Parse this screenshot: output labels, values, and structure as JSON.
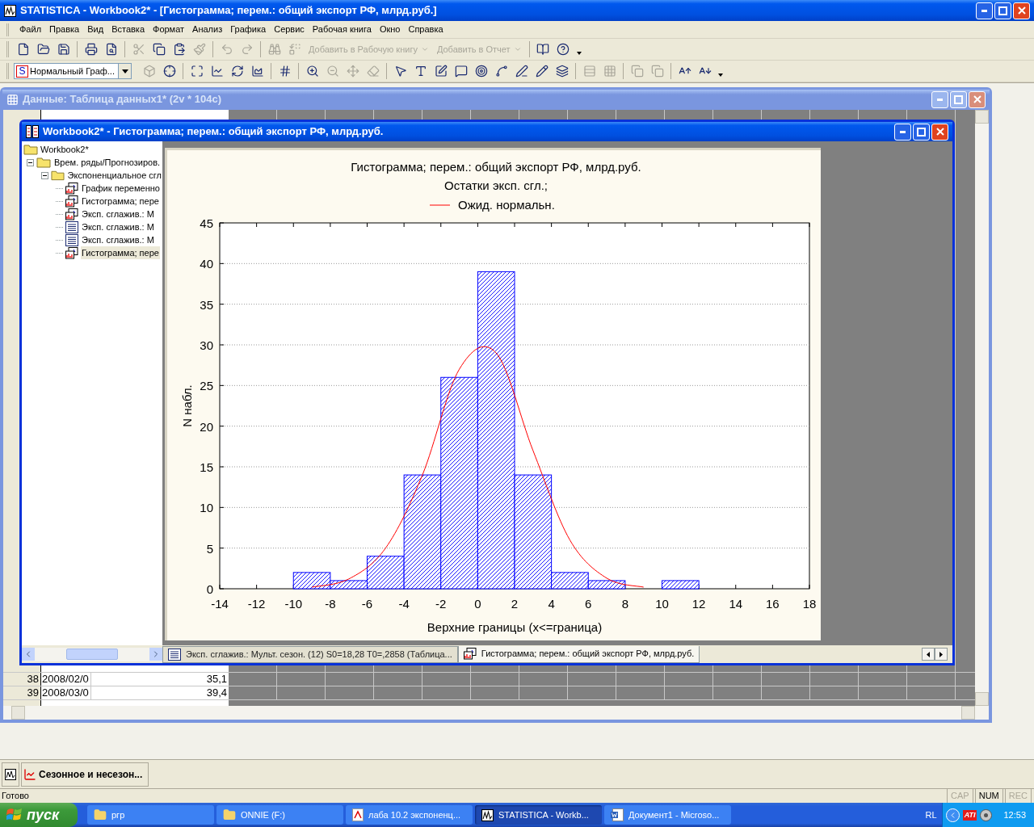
{
  "app_window": {
    "title": "STATISTICA - Workbook2* - [Гистограмма; перем.: общий экспорт РФ, млрд.руб.]",
    "active": true
  },
  "menu": [
    "Файл",
    "Правка",
    "Вид",
    "Вставка",
    "Формат",
    "Анализ",
    "Графика",
    "Сервис",
    "Рабочая книга",
    "Окно",
    "Справка"
  ],
  "toolbar_standard": [
    {
      "kind": "icon",
      "disabled": false
    },
    {
      "kind": "icon",
      "disabled": false
    },
    {
      "kind": "icon",
      "disabled": false
    },
    {
      "kind": "separator"
    },
    {
      "kind": "icon",
      "disabled": false
    },
    {
      "kind": "icon",
      "disabled": false
    },
    {
      "kind": "separator"
    },
    {
      "kind": "icon",
      "disabled": true
    },
    {
      "kind": "icon",
      "disabled": false
    },
    {
      "kind": "icon",
      "disabled": false
    },
    {
      "kind": "icon",
      "disabled": true
    },
    {
      "kind": "separator"
    },
    {
      "kind": "icon",
      "disabled": true
    },
    {
      "kind": "icon",
      "disabled": true
    },
    {
      "kind": "separator"
    },
    {
      "kind": "icon",
      "disabled": true
    },
    {
      "kind": "icon",
      "disabled": true
    },
    {
      "kind": "dropdown",
      "label": "Добавить в Рабочую книгу",
      "disabled": true
    },
    {
      "kind": "dropdown",
      "label": "Добавить в Отчет",
      "disabled": true
    },
    {
      "kind": "separator"
    },
    {
      "kind": "icon",
      "disabled": false
    },
    {
      "kind": "icon",
      "disabled": false
    },
    {
      "kind": "more"
    }
  ],
  "toolbar_graphs": [
    {
      "kind": "combo",
      "badge": "S",
      "label": "Нормальный Граф..."
    },
    {
      "kind": "icon",
      "disabled": true
    },
    {
      "kind": "icon",
      "disabled": false
    },
    {
      "kind": "separator"
    },
    {
      "kind": "icon",
      "disabled": false
    },
    {
      "kind": "icon",
      "disabled": false
    },
    {
      "kind": "icon",
      "disabled": false
    },
    {
      "kind": "icon",
      "disabled": false
    },
    {
      "kind": "separator"
    },
    {
      "kind": "icon",
      "disabled": false
    },
    {
      "kind": "separator"
    },
    {
      "kind": "icon",
      "disabled": false
    },
    {
      "kind": "icon",
      "disabled": true
    },
    {
      "kind": "icon",
      "disabled": true
    },
    {
      "kind": "icon",
      "disabled": true
    },
    {
      "kind": "separator"
    },
    {
      "kind": "icon",
      "disabled": false
    },
    {
      "kind": "icon",
      "disabled": false
    },
    {
      "kind": "icon",
      "disabled": false
    },
    {
      "kind": "icon",
      "disabled": false
    },
    {
      "kind": "icon",
      "disabled": false
    },
    {
      "kind": "icon",
      "disabled": false
    },
    {
      "kind": "icon",
      "disabled": false
    },
    {
      "kind": "icon",
      "disabled": false
    },
    {
      "kind": "icon",
      "disabled": false
    },
    {
      "kind": "separator"
    },
    {
      "kind": "icon",
      "disabled": true
    },
    {
      "kind": "icon",
      "disabled": true
    },
    {
      "kind": "separator"
    },
    {
      "kind": "icon",
      "disabled": true
    },
    {
      "kind": "icon",
      "disabled": true
    },
    {
      "kind": "separator"
    },
    {
      "kind": "icon",
      "disabled": false
    },
    {
      "kind": "icon",
      "disabled": false
    },
    {
      "kind": "more"
    }
  ],
  "data_window": {
    "title": "Данные: Таблица данных1* (2v * 104c)",
    "active": false,
    "rows": [
      {
        "number": "38",
        "date": "2008/02/0",
        "value": "35,1"
      },
      {
        "number": "39",
        "date": "2008/03/0",
        "value": "39,4"
      }
    ]
  },
  "workbook_window": {
    "title": "Workbook2* - Гистограмма; перем.: общий экспорт РФ, млрд.руб.",
    "active": true,
    "tree": {
      "label": "Workbook2*",
      "children": [
        {
          "kind": "folder",
          "label": "Врем. ряды/Прогнозиров.",
          "expanded": true,
          "selected": false,
          "children": [
            {
              "kind": "folder",
              "label": "Экспоненциальное сгл",
              "expanded": true,
              "selected": false,
              "children": [
                {
                  "kind": "graph",
                  "label": "График переменно",
                  "selected": false
                },
                {
                  "kind": "graph",
                  "label": "Гистограмма; пере",
                  "selected": false
                },
                {
                  "kind": "graph",
                  "label": "Эксп. сглажив.: М",
                  "selected": false
                },
                {
                  "kind": "table",
                  "label": "Эксп. сглажив.: М",
                  "selected": false
                },
                {
                  "kind": "table",
                  "label": "Эксп. сглажив.: М",
                  "selected": false
                },
                {
                  "kind": "graph",
                  "label": "Гистограмма; пере",
                  "selected": true
                }
              ]
            }
          ]
        }
      ]
    },
    "tabs": [
      {
        "kind": "table",
        "label": "Эксп. сглажив.: Мульт. сезон. (12) S0=18,28 T0=,2858 (Таблица...",
        "selected": false
      },
      {
        "kind": "graph",
        "label": "Гистограмма; перем.: общий экспорт РФ, млрд.руб.",
        "selected": true
      }
    ],
    "chart": {
      "subtitle": "Остатки эксп. сгл.;",
      "chart_data": {
        "type": "bar",
        "title": "Гистограмма; перем.: общий экспорт РФ, млрд.руб.",
        "xlabel": "Верхние границы (x<=граница)",
        "ylabel": "N набл.",
        "x": [
          -9,
          -7,
          -5,
          -3,
          -1,
          1,
          3,
          5,
          7,
          9,
          11
        ],
        "series": [
          {
            "color": "#0000ff",
            "values": [
              2,
              1,
              4,
              14,
              26,
              39,
              14,
              2,
              1,
              0,
              1
            ]
          },
          {
            "name": "Ожид. нормальн.",
            "type": "line",
            "color": "#ff0000",
            "values": [
              0.2,
              1.2,
              5,
              14,
              27,
              29,
              17,
              6,
              1.3,
              0.2,
              null
            ]
          }
        ],
        "xlim": [
          -14,
          18
        ],
        "ylim": [
          0,
          45
        ],
        "grid": true,
        "xticks": [
          -14,
          -12,
          -10,
          -8,
          -6,
          -4,
          -2,
          0,
          2,
          4,
          6,
          8,
          10,
          12,
          14,
          16,
          18
        ],
        "yticks": [
          0,
          5,
          10,
          15,
          20,
          25,
          30,
          35,
          40,
          45
        ]
      }
    }
  },
  "minimized_windows": [
    {
      "kind": "icon"
    },
    {
      "kind": "labeled",
      "label": "Сезонное и несезон..."
    }
  ],
  "status_bar": {
    "text": "Готово",
    "indicators": [
      {
        "label": "CAP",
        "on": false
      },
      {
        "label": "NUM",
        "on": true
      },
      {
        "label": "REC",
        "on": false
      }
    ]
  },
  "taskbar": {
    "start": "пуск",
    "buttons": [
      {
        "kind": "folder",
        "label": "ргр",
        "selected": false
      },
      {
        "kind": "folder",
        "label": "ONNIE (F:)",
        "selected": false
      },
      {
        "kind": "pdf",
        "label": "лаба 10.2 экспоненц...",
        "selected": false
      },
      {
        "kind": "statistica",
        "label": "STATISTICA - Workb...",
        "selected": true
      },
      {
        "kind": "word",
        "label": "Документ1 - Microso...",
        "selected": false
      }
    ],
    "tray": {
      "language": "RL",
      "badge": "ATI",
      "time": "12:53"
    }
  }
}
